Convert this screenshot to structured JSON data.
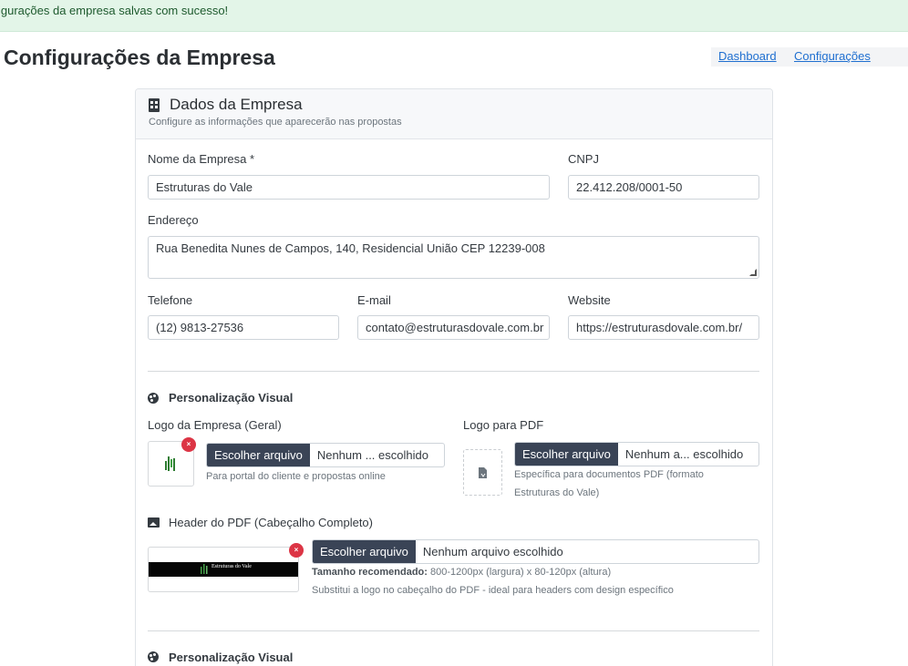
{
  "alert": {
    "text": "igurações da empresa salvas com sucesso!"
  },
  "page": {
    "title": "Configurações da Empresa"
  },
  "nav": {
    "dashboard": "Dashboard",
    "config": "Configurações"
  },
  "card": {
    "title": "Dados da Empresa",
    "subtitle": "Configure as informações que aparecerão nas propostas"
  },
  "form": {
    "nome_label": "Nome da Empresa *",
    "nome_value": "Estruturas do Vale",
    "cnpj_label": "CNPJ",
    "cnpj_value": "22.412.208/0001-50",
    "endereco_label": "Endereço",
    "endereco_value": "Rua Benedita Nunes de Campos, 140, Residencial União CEP 12239-008",
    "telefone_label": "Telefone",
    "telefone_value": "(12) 9813-27536",
    "email_label": "E-mail",
    "email_value": "contato@estruturasdovale.com.br",
    "website_label": "Website",
    "website_value": "https://estruturasdovale.com.br/"
  },
  "visual": {
    "section_title": "Personalização Visual",
    "logo_label": "Logo da Empresa (Geral)",
    "logo_btn": "Escolher arquivo",
    "logo_file": "Nenhum ... escolhido",
    "logo_help": "Para portal do cliente e propostas online",
    "pdf_logo_label": "Logo para PDF",
    "pdf_btn": "Escolher arquivo",
    "pdf_file": "Nenhum a... escolhido",
    "pdf_help_1": "Específica para documentos PDF (formato",
    "pdf_help_2": "Estruturas do Vale)",
    "header_label": "Header do PDF (Cabeçalho Completo)",
    "header_btn": "Escolher arquivo",
    "header_file": "Nenhum arquivo escolhido",
    "header_help_bold": "Tamanho recomendado:",
    "header_help_rest": " 800-1200px (largura) x 80-120px (altura)",
    "header_help_2": "Substitui a logo no cabeçalho do PDF - ideal para headers com design específico",
    "header_brand": "Estruturas do Vale",
    "remove_symbol": "×"
  },
  "visual2": {
    "section_title": "Personalização Visual"
  },
  "colors": {
    "accent": "#3a4456",
    "success_bg": "#e3f5e8",
    "link": "#1f6fd0",
    "danger": "#dc3545"
  }
}
